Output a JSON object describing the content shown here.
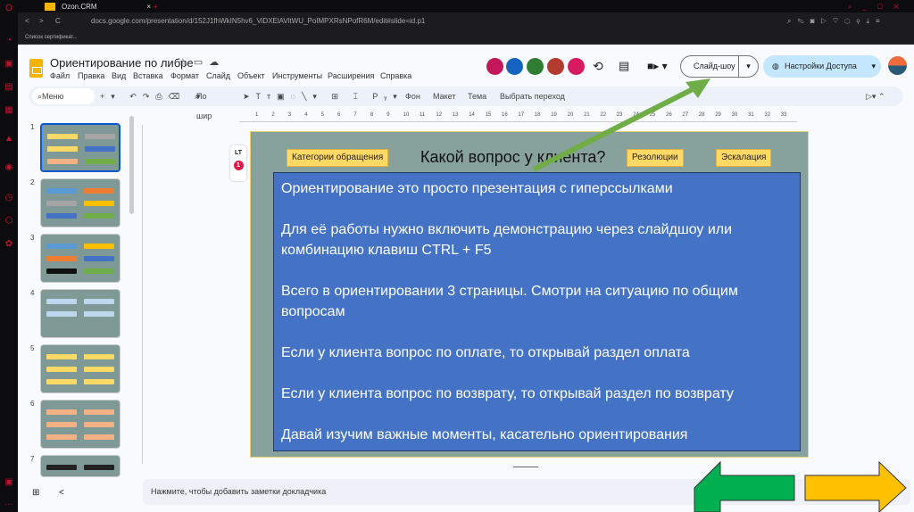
{
  "browser": {
    "tab_title": "Ozon.CRM",
    "url": "docs.google.com/presentation/d/152J1fhWkIN5hv6_ViDXElAVltWU_PoIMPXRsNPofR6M/edit#slide=id.p1",
    "bookmark": "Список сертификат..."
  },
  "doc": {
    "title": "Ориентирование по либре",
    "menu": [
      "Файл",
      "Правка",
      "Вид",
      "Вставка",
      "Формат",
      "Слайд",
      "Объект",
      "Инструменты",
      "Расширения",
      "Справка"
    ],
    "slideshow_label": "Слайд-шоу",
    "share_label": "Настройки Доступа"
  },
  "toolbar": {
    "search": "Меню",
    "zoom": "По шир",
    "background": "Фон",
    "layout": "Макет",
    "theme": "Тема",
    "transition": "Выбрать переход"
  },
  "ruler": [
    "1",
    "2",
    "3",
    "4",
    "5",
    "6",
    "7",
    "8",
    "9",
    "10",
    "11",
    "12",
    "13",
    "14",
    "15",
    "16",
    "17",
    "18",
    "19",
    "20",
    "21",
    "22",
    "23",
    "24",
    "25",
    "26",
    "27",
    "28",
    "29",
    "30",
    "31",
    "32",
    "33"
  ],
  "slides": [
    "1",
    "2",
    "3",
    "4",
    "5",
    "6",
    "7"
  ],
  "extension": {
    "label": "LT",
    "badge": "1"
  },
  "slide": {
    "title": "Какой вопрос у клиента?",
    "buttons": [
      "Категории обращения",
      "Резолюции",
      "Эскалация"
    ],
    "paragraphs": [
      "Ориентирование это просто презентация с гиперссылками",
      "Для её работы нужно включить демонстрацию через слайдшоу или комбинацию клавиш CTRL + F5",
      "Всего в ориентировании 3 страницы. Смотри на ситуацию по общим вопросам",
      "Если у клиента вопрос по оплате, то открывай раздел оплата",
      "Если у клиента вопрос по возврату, то открывай раздел по возврату",
      "Давай изучим важные моменты, касательно ориентирования"
    ]
  },
  "notes_placeholder": "Нажмите, чтобы добавить заметки докладчика",
  "colors": {
    "slide_bg": "#87a29d",
    "blue_box": "#4472c4",
    "yellow_btn": "#ffd966",
    "green_arrow": "#00b050",
    "yellow_arrow": "#ffc000",
    "annotation": "#70ad47"
  }
}
